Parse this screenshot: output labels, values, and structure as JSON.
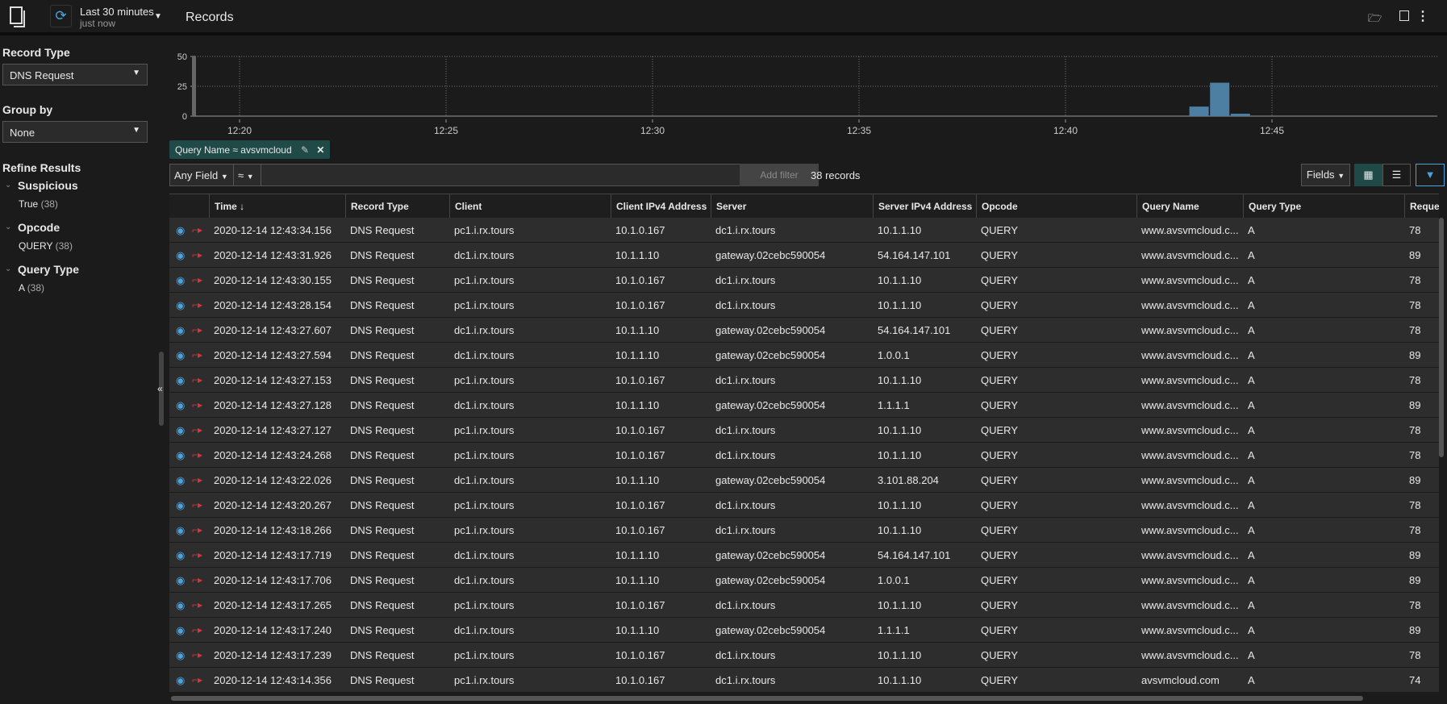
{
  "header": {
    "title": "Records",
    "time_range": "Last 30 minutes",
    "time_sub": "just now"
  },
  "sidebar": {
    "record_type_label": "Record Type",
    "record_type_value": "DNS Request",
    "group_by_label": "Group by",
    "group_by_value": "None",
    "refine_label": "Refine Results",
    "facets": [
      {
        "name": "Suspicious",
        "items": [
          {
            "value": "True",
            "count": "(38)"
          }
        ]
      },
      {
        "name": "Opcode",
        "items": [
          {
            "value": "QUERY",
            "count": "(38)"
          }
        ]
      },
      {
        "name": "Query Type",
        "items": [
          {
            "value": "A",
            "count": "(38)"
          }
        ]
      }
    ]
  },
  "chart_data": {
    "type": "bar",
    "y_ticks": [
      "0",
      "25",
      "50"
    ],
    "ylim": [
      0,
      50
    ],
    "x_ticks": [
      "12:20",
      "12:25",
      "12:30",
      "12:35",
      "12:40",
      "12:45"
    ],
    "bars": [
      {
        "time": "12:43",
        "value": 8
      },
      {
        "time": "12:43:30",
        "value": 28
      },
      {
        "time": "12:44",
        "value": 2
      }
    ],
    "bar_color": "#4d7fa3",
    "grid": true
  },
  "filter": {
    "chip": "Query Name ≈ avsvmcloud",
    "field": "Any Field",
    "operator": "≈",
    "placeholder": "",
    "add_label": "Add filter",
    "count": "38 records",
    "fields_label": "Fields"
  },
  "table": {
    "columns": [
      "Time ↓",
      "Record Type",
      "Client",
      "Client IPv4 Address",
      "Server",
      "Server IPv4 Address",
      "Opcode",
      "Query Name",
      "Query Type",
      "Request"
    ],
    "rows": [
      [
        "2020-12-14 12:43:34.156",
        "DNS Request",
        "pc1.i.rx.tours",
        "10.1.0.167",
        "dc1.i.rx.tours",
        "10.1.1.10",
        "QUERY",
        "www.avsvmcloud.c...",
        "A",
        "78"
      ],
      [
        "2020-12-14 12:43:31.926",
        "DNS Request",
        "dc1.i.rx.tours",
        "10.1.1.10",
        "gateway.02cebc590054",
        "54.164.147.101",
        "QUERY",
        "www.avsvmcloud.c...",
        "A",
        "89"
      ],
      [
        "2020-12-14 12:43:30.155",
        "DNS Request",
        "pc1.i.rx.tours",
        "10.1.0.167",
        "dc1.i.rx.tours",
        "10.1.1.10",
        "QUERY",
        "www.avsvmcloud.c...",
        "A",
        "78"
      ],
      [
        "2020-12-14 12:43:28.154",
        "DNS Request",
        "pc1.i.rx.tours",
        "10.1.0.167",
        "dc1.i.rx.tours",
        "10.1.1.10",
        "QUERY",
        "www.avsvmcloud.c...",
        "A",
        "78"
      ],
      [
        "2020-12-14 12:43:27.607",
        "DNS Request",
        "dc1.i.rx.tours",
        "10.1.1.10",
        "gateway.02cebc590054",
        "54.164.147.101",
        "QUERY",
        "www.avsvmcloud.c...",
        "A",
        "78"
      ],
      [
        "2020-12-14 12:43:27.594",
        "DNS Request",
        "dc1.i.rx.tours",
        "10.1.1.10",
        "gateway.02cebc590054",
        "1.0.0.1",
        "QUERY",
        "www.avsvmcloud.c...",
        "A",
        "89"
      ],
      [
        "2020-12-14 12:43:27.153",
        "DNS Request",
        "pc1.i.rx.tours",
        "10.1.0.167",
        "dc1.i.rx.tours",
        "10.1.1.10",
        "QUERY",
        "www.avsvmcloud.c...",
        "A",
        "78"
      ],
      [
        "2020-12-14 12:43:27.128",
        "DNS Request",
        "dc1.i.rx.tours",
        "10.1.1.10",
        "gateway.02cebc590054",
        "1.1.1.1",
        "QUERY",
        "www.avsvmcloud.c...",
        "A",
        "89"
      ],
      [
        "2020-12-14 12:43:27.127",
        "DNS Request",
        "pc1.i.rx.tours",
        "10.1.0.167",
        "dc1.i.rx.tours",
        "10.1.1.10",
        "QUERY",
        "www.avsvmcloud.c...",
        "A",
        "78"
      ],
      [
        "2020-12-14 12:43:24.268",
        "DNS Request",
        "pc1.i.rx.tours",
        "10.1.0.167",
        "dc1.i.rx.tours",
        "10.1.1.10",
        "QUERY",
        "www.avsvmcloud.c...",
        "A",
        "78"
      ],
      [
        "2020-12-14 12:43:22.026",
        "DNS Request",
        "dc1.i.rx.tours",
        "10.1.1.10",
        "gateway.02cebc590054",
        "3.101.88.204",
        "QUERY",
        "www.avsvmcloud.c...",
        "A",
        "89"
      ],
      [
        "2020-12-14 12:43:20.267",
        "DNS Request",
        "pc1.i.rx.tours",
        "10.1.0.167",
        "dc1.i.rx.tours",
        "10.1.1.10",
        "QUERY",
        "www.avsvmcloud.c...",
        "A",
        "78"
      ],
      [
        "2020-12-14 12:43:18.266",
        "DNS Request",
        "pc1.i.rx.tours",
        "10.1.0.167",
        "dc1.i.rx.tours",
        "10.1.1.10",
        "QUERY",
        "www.avsvmcloud.c...",
        "A",
        "78"
      ],
      [
        "2020-12-14 12:43:17.719",
        "DNS Request",
        "dc1.i.rx.tours",
        "10.1.1.10",
        "gateway.02cebc590054",
        "54.164.147.101",
        "QUERY",
        "www.avsvmcloud.c...",
        "A",
        "89"
      ],
      [
        "2020-12-14 12:43:17.706",
        "DNS Request",
        "dc1.i.rx.tours",
        "10.1.1.10",
        "gateway.02cebc590054",
        "1.0.0.1",
        "QUERY",
        "www.avsvmcloud.c...",
        "A",
        "89"
      ],
      [
        "2020-12-14 12:43:17.265",
        "DNS Request",
        "pc1.i.rx.tours",
        "10.1.0.167",
        "dc1.i.rx.tours",
        "10.1.1.10",
        "QUERY",
        "www.avsvmcloud.c...",
        "A",
        "78"
      ],
      [
        "2020-12-14 12:43:17.240",
        "DNS Request",
        "dc1.i.rx.tours",
        "10.1.1.10",
        "gateway.02cebc590054",
        "1.1.1.1",
        "QUERY",
        "www.avsvmcloud.c...",
        "A",
        "89"
      ],
      [
        "2020-12-14 12:43:17.239",
        "DNS Request",
        "pc1.i.rx.tours",
        "10.1.0.167",
        "dc1.i.rx.tours",
        "10.1.1.10",
        "QUERY",
        "www.avsvmcloud.c...",
        "A",
        "78"
      ],
      [
        "2020-12-14 12:43:14.356",
        "DNS Request",
        "pc1.i.rx.tours",
        "10.1.0.167",
        "dc1.i.rx.tours",
        "10.1.1.10",
        "QUERY",
        "avsvmcloud.com",
        "A",
        "74"
      ]
    ]
  },
  "colors": {
    "accent": "#4aa3df",
    "chip": "#1f4a47",
    "alert": "#d9343d"
  }
}
